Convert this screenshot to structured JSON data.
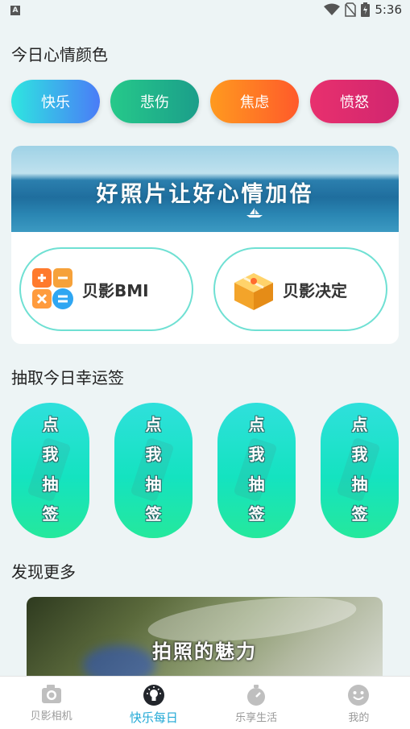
{
  "status_bar": {
    "time": "5:36",
    "notification_icon": "a-icon"
  },
  "mood": {
    "title": "今日心情颜色",
    "buttons": [
      {
        "label": "快乐",
        "colors": [
          "#2ee6e0",
          "#4a7cf7"
        ]
      },
      {
        "label": "悲伤",
        "colors": [
          "#26c98a",
          "#1b9e8a"
        ]
      },
      {
        "label": "焦虑",
        "colors": [
          "#ff9a1f",
          "#ff5a2a"
        ]
      },
      {
        "label": "愤怒",
        "colors": [
          "#e8306e",
          "#d1266f"
        ]
      }
    ]
  },
  "banner": {
    "slogan": "好照片让好心情加倍"
  },
  "tools": [
    {
      "label": "贝影BMI",
      "icon": "calculator-icon"
    },
    {
      "label": "贝影决定",
      "icon": "box-icon"
    }
  ],
  "lottery": {
    "title": "抽取今日幸运签",
    "cards": [
      {
        "chars": [
          "点",
          "我",
          "抽",
          "签"
        ]
      },
      {
        "chars": [
          "点",
          "我",
          "抽",
          "签"
        ]
      },
      {
        "chars": [
          "点",
          "我",
          "抽",
          "签"
        ]
      },
      {
        "chars": [
          "点",
          "我",
          "抽",
          "签"
        ]
      }
    ]
  },
  "discover": {
    "title": "发现更多",
    "caption": "拍照的魅力"
  },
  "tabbar": {
    "tabs": [
      {
        "label": "贝影相机",
        "icon": "camera-icon",
        "active": false
      },
      {
        "label": "快乐每日",
        "icon": "bulb-icon",
        "active": true
      },
      {
        "label": "乐享生活",
        "icon": "stopwatch-icon",
        "active": false
      },
      {
        "label": "我的",
        "icon": "smile-icon",
        "active": false
      }
    ],
    "active_color": "#22a9d6",
    "inactive_color": "#999999"
  }
}
